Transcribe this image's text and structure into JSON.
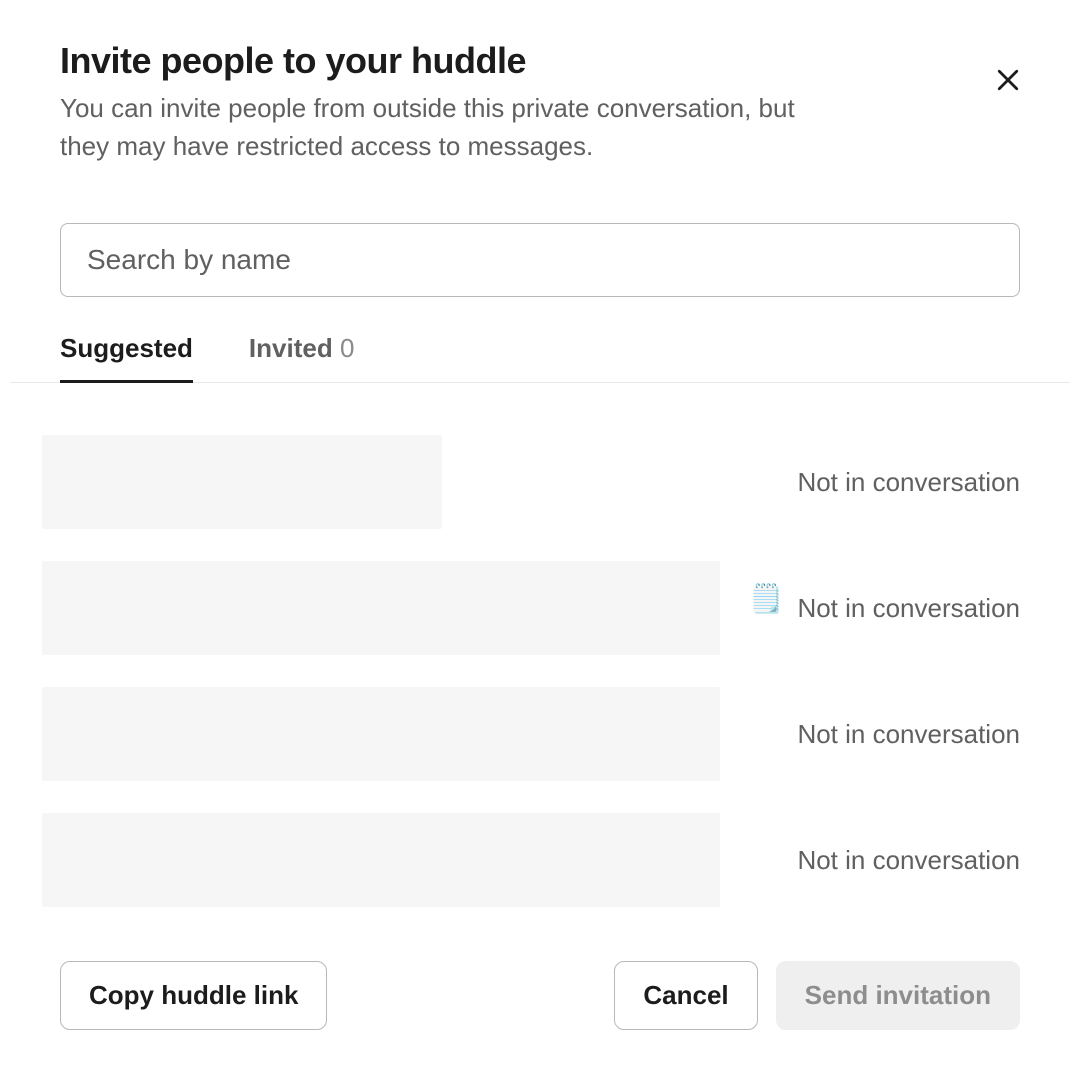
{
  "header": {
    "title": "Invite people to your huddle",
    "subtitle": "You can invite people from outside this private conversation, but they may have restricted access to messages."
  },
  "search": {
    "placeholder": "Search by name",
    "value": ""
  },
  "tabs": {
    "suggested_label": "Suggested",
    "invited_label": "Invited",
    "invited_count": "0"
  },
  "suggested": [
    {
      "status": "Not in conversation",
      "icon": ""
    },
    {
      "status": "Not in conversation",
      "icon": "🗒️"
    },
    {
      "status": "Not in conversation",
      "icon": ""
    },
    {
      "status": "Not in conversation",
      "icon": ""
    }
  ],
  "footer": {
    "copy_link_label": "Copy huddle link",
    "cancel_label": "Cancel",
    "send_label": "Send invitation"
  }
}
